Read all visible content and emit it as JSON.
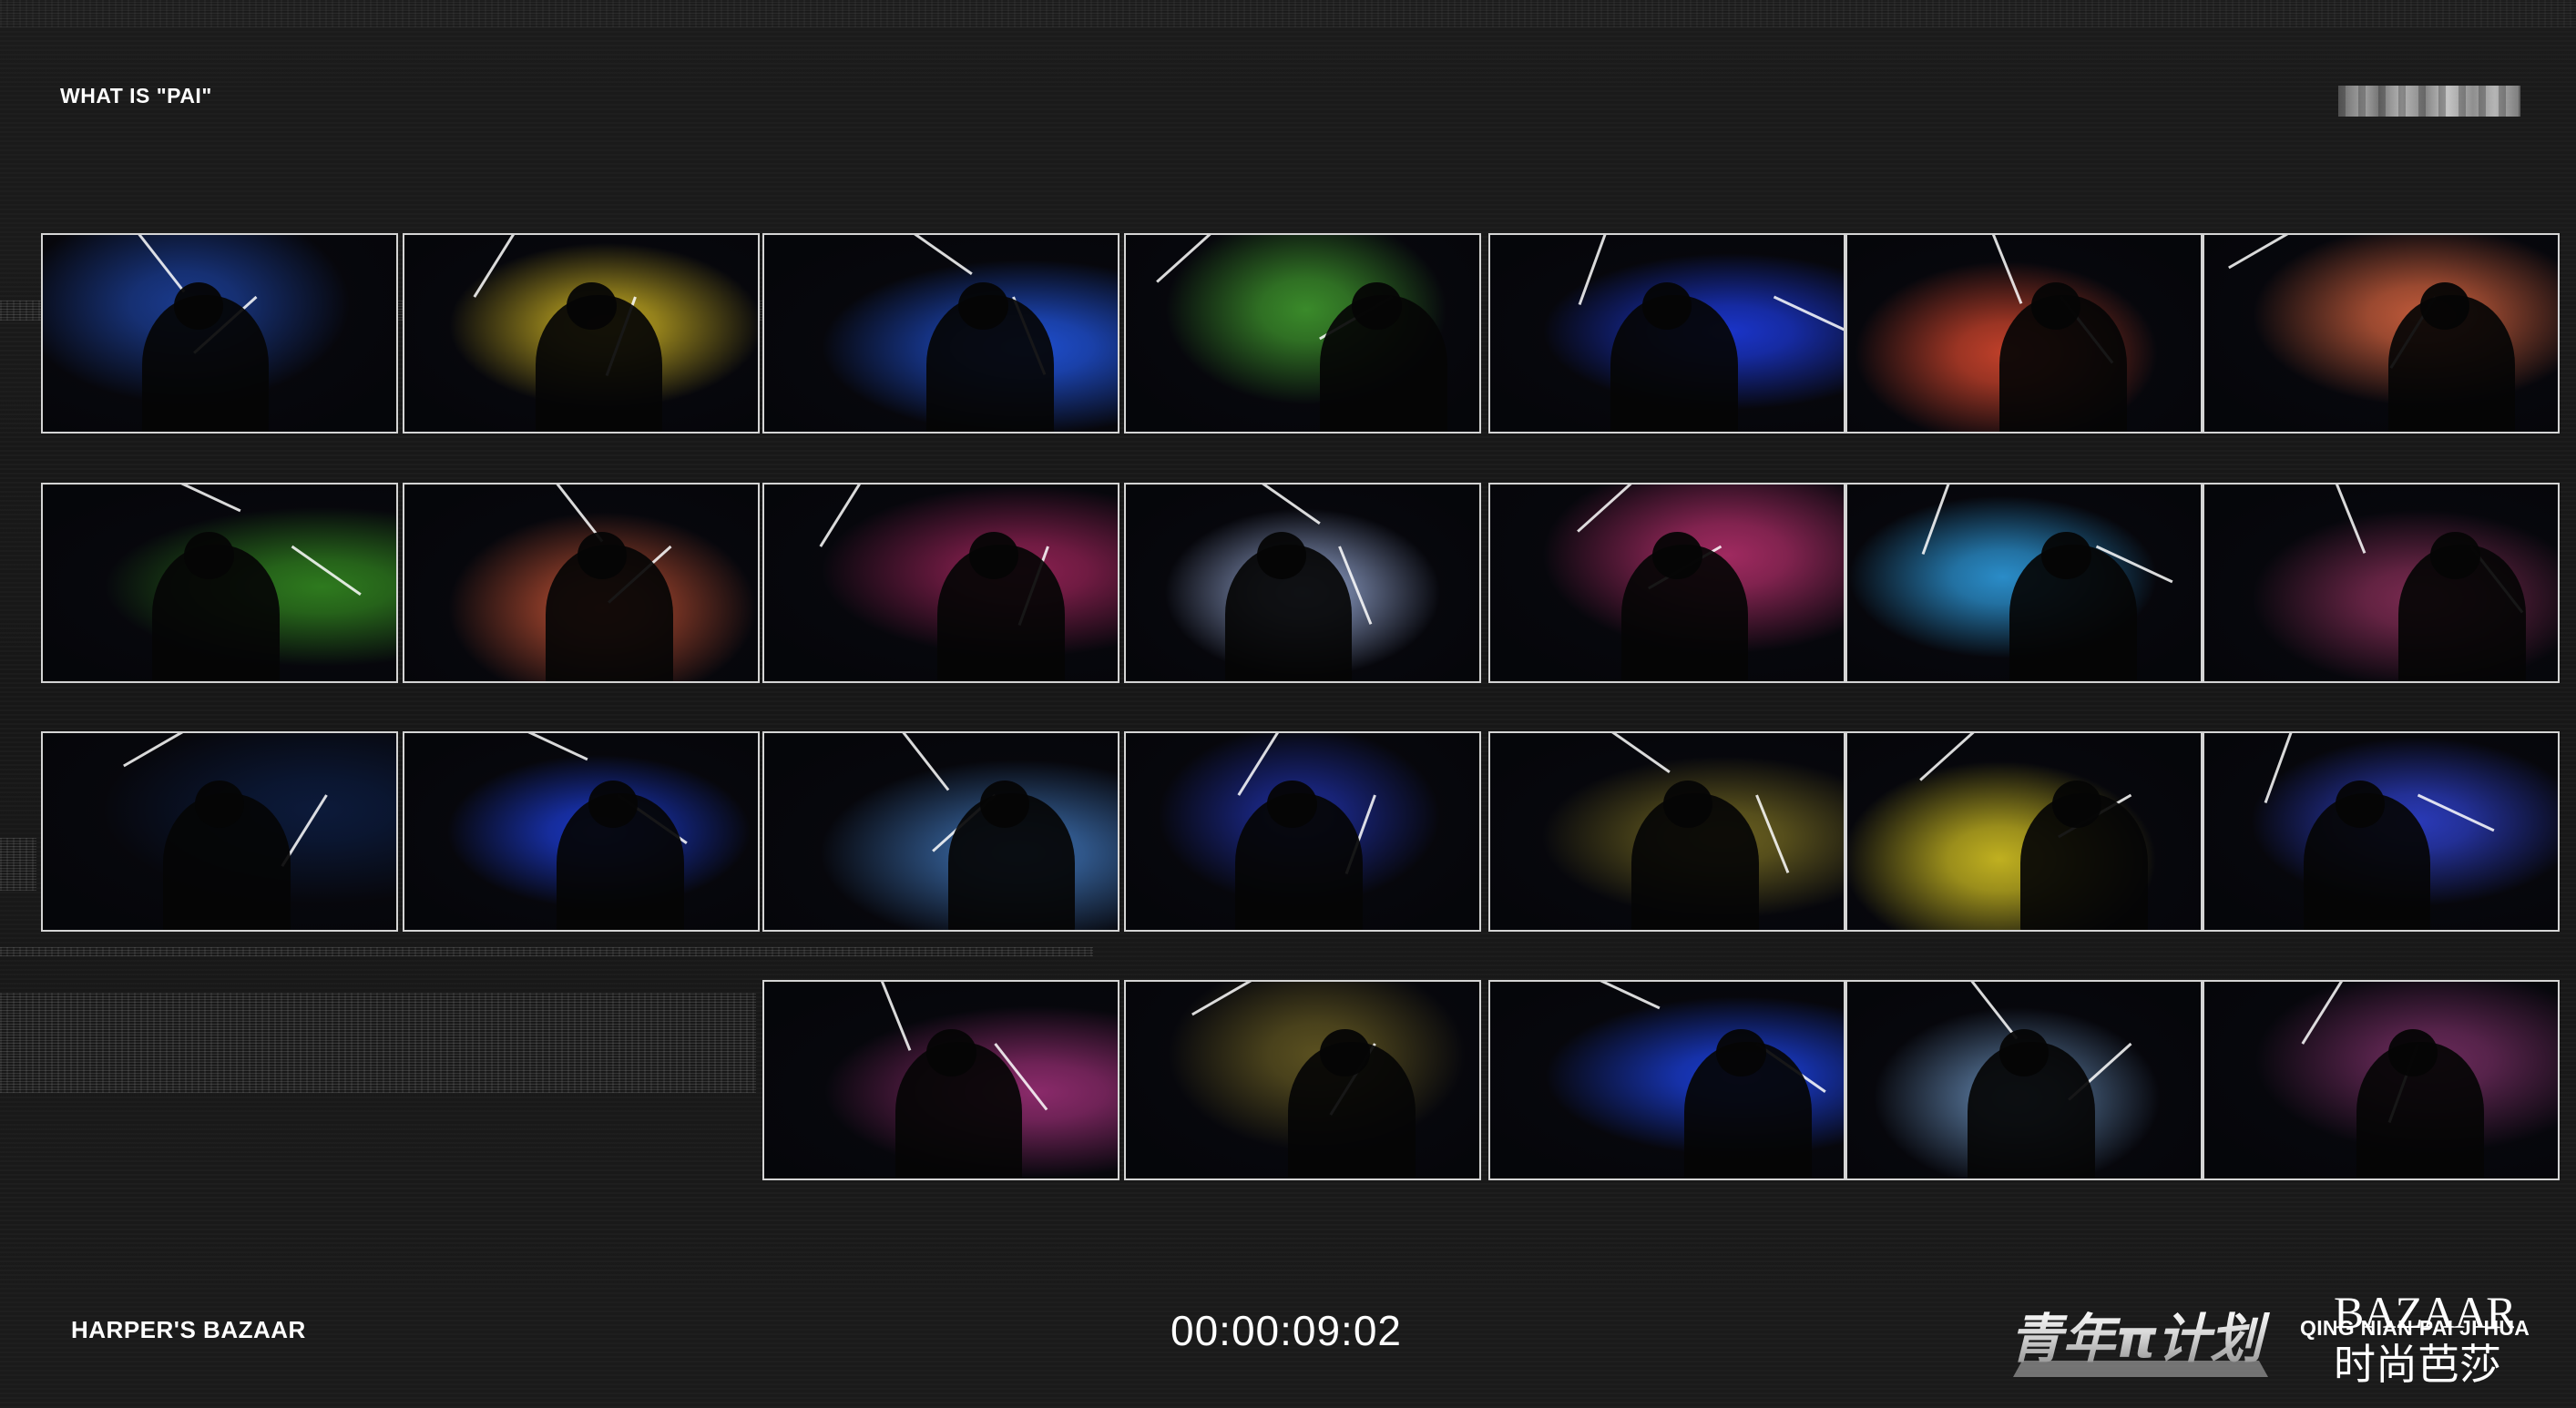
{
  "header": {
    "title": "WHAT IS \"PAI\""
  },
  "footer": {
    "left_label": "HARPER'S BAZAAR",
    "timecode": "00:00:09:02",
    "right_label": "QING NIAN PAI JI HUA",
    "youth_logo_text": "青年π计划",
    "bazaar_logo_text": "BAZAAR",
    "bazaar_logo_chinese": "时尚芭莎"
  },
  "contact_sheet": {
    "frames": [
      {
        "row": 0,
        "col": 0,
        "color": "#1a3a8c",
        "subject": "person-in-front-of-sky"
      },
      {
        "row": 0,
        "col": 1,
        "color": "#b8a020",
        "subject": "silhouette-yellow-light"
      },
      {
        "row": 0,
        "col": 2,
        "color": "#1f4fd0",
        "subject": "silhouette-blue-light"
      },
      {
        "row": 0,
        "col": 3,
        "color": "#3a8a2a",
        "subject": "silhouette-green-light"
      },
      {
        "row": 0,
        "col": 4,
        "color": "#1a34c8",
        "subject": "silhouette-blue-light"
      },
      {
        "row": 0,
        "col": 5,
        "color": "#c0402a",
        "subject": "silhouette-green-red-light"
      },
      {
        "row": 0,
        "col": 6,
        "color": "#c05a3a",
        "subject": "silhouette-red-yellow-light"
      },
      {
        "row": 1,
        "col": 0,
        "color": "#2e7a1e",
        "subject": "silhouette-green-light"
      },
      {
        "row": 1,
        "col": 1,
        "color": "#b04a30",
        "subject": "silhouette-orange-light"
      },
      {
        "row": 1,
        "col": 2,
        "color": "#8a2050",
        "subject": "silhouette-magenta-light"
      },
      {
        "row": 1,
        "col": 3,
        "color": "#8898c0",
        "subject": "silhouette-white-light"
      },
      {
        "row": 1,
        "col": 4,
        "color": "#a02a60",
        "subject": "silhouette-pink-light"
      },
      {
        "row": 1,
        "col": 5,
        "color": "#2a8cc8",
        "subject": "silhouette-cyan-light"
      },
      {
        "row": 1,
        "col": 6,
        "color": "#7a2a50",
        "subject": "silhouette-purple-light"
      },
      {
        "row": 2,
        "col": 0,
        "color": "#0c1a3a",
        "subject": "silhouette-dark-blue"
      },
      {
        "row": 2,
        "col": 1,
        "color": "#1a36c0",
        "subject": "blue-light-burst"
      },
      {
        "row": 2,
        "col": 2,
        "color": "#3a6aa8",
        "subject": "silhouette-blue-white-light"
      },
      {
        "row": 2,
        "col": 3,
        "color": "#1c2a90",
        "subject": "silhouette-blue"
      },
      {
        "row": 2,
        "col": 4,
        "color": "#6a6020",
        "subject": "silhouette-yellow-dim"
      },
      {
        "row": 2,
        "col": 5,
        "color": "#c0b020",
        "subject": "silhouette-yellow-red-light"
      },
      {
        "row": 2,
        "col": 6,
        "color": "#2a3ab8",
        "subject": "silhouette-blue-purple"
      },
      {
        "row": 3,
        "col": 2,
        "color": "#8a2a6a",
        "subject": "silhouette-red-purple"
      },
      {
        "row": 3,
        "col": 3,
        "color": "#5a5020",
        "subject": "silhouette-olive"
      },
      {
        "row": 3,
        "col": 4,
        "color": "#1a3cd0",
        "subject": "silhouette-blue-light"
      },
      {
        "row": 3,
        "col": 5,
        "color": "#5a7aa0",
        "subject": "silhouette-steel-blue"
      },
      {
        "row": 3,
        "col": 6,
        "color": "#6a2a5a",
        "subject": "silhouette-red-purple"
      }
    ]
  }
}
